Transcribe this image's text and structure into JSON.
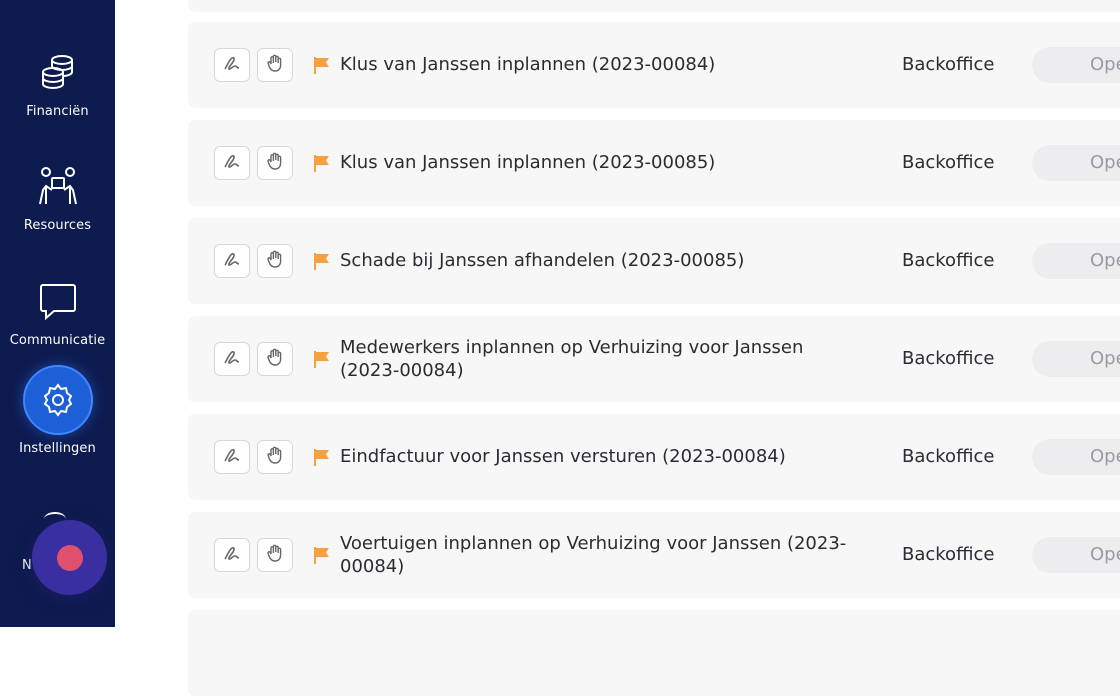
{
  "sidebar": {
    "items": [
      {
        "label": "Financiën",
        "icon": "coins-stack-icon"
      },
      {
        "label": "Resources",
        "icon": "people-icon"
      },
      {
        "label": "Communicatie",
        "icon": "chat-bubble-icon"
      },
      {
        "label": "Instellingen",
        "icon": "gear-icon",
        "active": true
      }
    ],
    "partial_item_label": "N",
    "active_color": "#1c5fd6",
    "background_color": "#0d1b4f"
  },
  "chat_widget": {
    "icon": "chat-launcher-icon",
    "color": "#3a2fa0",
    "dot_color": "#e0506e"
  },
  "tasks": {
    "rows": [
      {
        "title": "Klus van Janssen inplannen (2023-00084)",
        "department": "Backoffice",
        "status": "Ope"
      },
      {
        "title": "Klus van Janssen inplannen (2023-00085)",
        "department": "Backoffice",
        "status": "Ope"
      },
      {
        "title": "Schade bij Janssen afhandelen (2023-00085)",
        "department": "Backoffice",
        "status": "Ope"
      },
      {
        "title": "Medewerkers inplannen op Verhuizing voor Janssen (2023-00084)",
        "department": "Backoffice",
        "status": "Ope"
      },
      {
        "title": "Eindfactuur voor Janssen versturen (2023-00084)",
        "department": "Backoffice",
        "status": "Ope"
      },
      {
        "title": "Voertuigen inplannen op Verhuizing voor Janssen (2023-00084)",
        "department": "Backoffice",
        "status": "Ope"
      }
    ],
    "flag_color": "#f5a142"
  }
}
